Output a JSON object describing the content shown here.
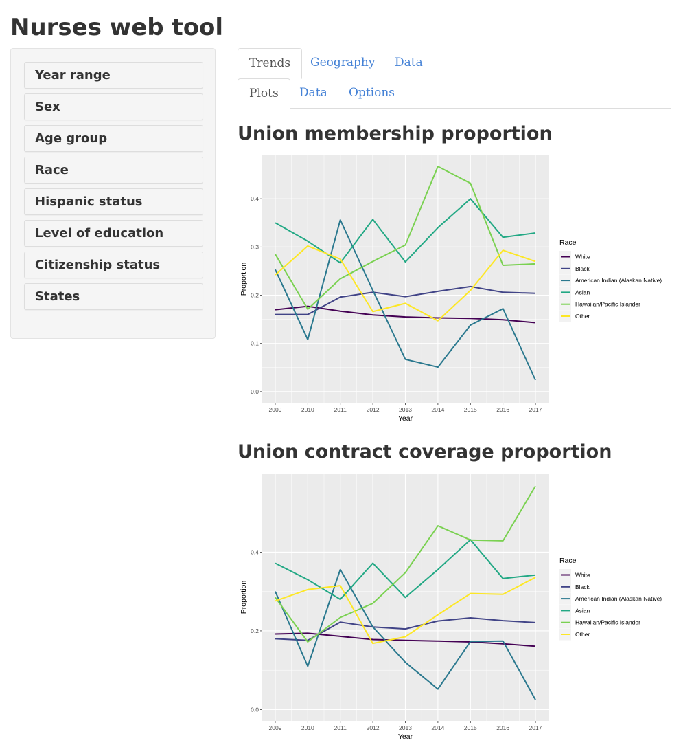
{
  "app": {
    "title": "Nurses web tool"
  },
  "sidebar": {
    "items": [
      {
        "label": "Year range"
      },
      {
        "label": "Sex"
      },
      {
        "label": "Age group"
      },
      {
        "label": "Race"
      },
      {
        "label": "Hispanic status"
      },
      {
        "label": "Level of education"
      },
      {
        "label": "Citizenship status"
      },
      {
        "label": "States"
      }
    ]
  },
  "tabs": {
    "main": [
      {
        "label": "Trends",
        "active": true
      },
      {
        "label": "Geography",
        "active": false
      },
      {
        "label": "Data",
        "active": false
      }
    ],
    "sub": [
      {
        "label": "Plots",
        "active": true
      },
      {
        "label": "Data",
        "active": false
      },
      {
        "label": "Options",
        "active": false
      }
    ]
  },
  "colors": {
    "panel_bg": "#ebebeb",
    "grid": "#ffffff",
    "link": "#4582d6",
    "series": [
      "#440154",
      "#414487",
      "#2a788e",
      "#22a884",
      "#7ad151",
      "#fde725"
    ]
  },
  "chart_data": [
    {
      "type": "line",
      "title": "Union membership proportion",
      "xlabel": "Year",
      "ylabel": "Proportion",
      "x": [
        2009,
        2010,
        2011,
        2012,
        2013,
        2014,
        2015,
        2016,
        2017
      ],
      "xlim": [
        2008.6,
        2017.4
      ],
      "ylim": [
        -0.023,
        0.49
      ],
      "yticks": [
        0.0,
        0.1,
        0.2,
        0.3,
        0.4
      ],
      "ytick_labels": [
        "0.0",
        "0.1",
        "0.2",
        "0.3",
        "0.4"
      ],
      "grid": true,
      "legend": {
        "title": "Race",
        "placement": "right"
      },
      "series": [
        {
          "name": "White",
          "values": [
            0.17,
            0.177,
            0.167,
            0.159,
            0.155,
            0.153,
            0.152,
            0.149,
            0.143
          ]
        },
        {
          "name": "Black",
          "values": [
            0.16,
            0.16,
            0.196,
            0.206,
            0.197,
            0.208,
            0.218,
            0.206,
            0.204
          ]
        },
        {
          "name": "American Indian (Alaskan Native)",
          "values": [
            0.253,
            0.108,
            0.356,
            0.21,
            0.067,
            0.051,
            0.138,
            0.172,
            0.024
          ]
        },
        {
          "name": "Asian",
          "values": [
            0.35,
            0.312,
            0.267,
            0.357,
            0.269,
            0.34,
            0.4,
            0.32,
            0.329
          ]
        },
        {
          "name": "Hawaiian/Pacific Islander",
          "values": [
            0.285,
            0.171,
            0.234,
            0.27,
            0.304,
            0.467,
            0.432,
            0.262,
            0.265
          ]
        },
        {
          "name": "Other",
          "values": [
            0.242,
            0.302,
            0.275,
            0.166,
            0.183,
            0.147,
            0.21,
            0.293,
            0.27
          ]
        }
      ]
    },
    {
      "type": "line",
      "title": "Union contract coverage proportion",
      "xlabel": "Year",
      "ylabel": "Proportion",
      "x": [
        2009,
        2010,
        2011,
        2012,
        2013,
        2014,
        2015,
        2016,
        2017
      ],
      "xlim": [
        2008.6,
        2017.4
      ],
      "ylim": [
        -0.029,
        0.6
      ],
      "yticks": [
        0.0,
        0.2,
        0.4
      ],
      "ytick_labels": [
        "0.0",
        "0.2",
        "0.4"
      ],
      "grid": true,
      "legend": {
        "title": "Race",
        "placement": "right"
      },
      "series": [
        {
          "name": "White",
          "values": [
            0.192,
            0.194,
            0.186,
            0.178,
            0.176,
            0.174,
            0.172,
            0.167,
            0.161
          ]
        },
        {
          "name": "Black",
          "values": [
            0.18,
            0.176,
            0.222,
            0.21,
            0.205,
            0.225,
            0.233,
            0.226,
            0.221
          ]
        },
        {
          "name": "American Indian (Alaskan Native)",
          "values": [
            0.3,
            0.11,
            0.356,
            0.21,
            0.12,
            0.052,
            0.173,
            0.174,
            0.025
          ]
        },
        {
          "name": "Asian",
          "values": [
            0.372,
            0.33,
            0.28,
            0.372,
            0.285,
            0.356,
            0.432,
            0.333,
            0.342
          ]
        },
        {
          "name": "Hawaiian/Pacific Islander",
          "values": [
            0.285,
            0.172,
            0.234,
            0.27,
            0.348,
            0.467,
            0.431,
            0.429,
            0.568
          ]
        },
        {
          "name": "Other",
          "values": [
            0.276,
            0.305,
            0.315,
            0.168,
            0.185,
            0.241,
            0.295,
            0.293,
            0.336
          ]
        }
      ]
    }
  ]
}
